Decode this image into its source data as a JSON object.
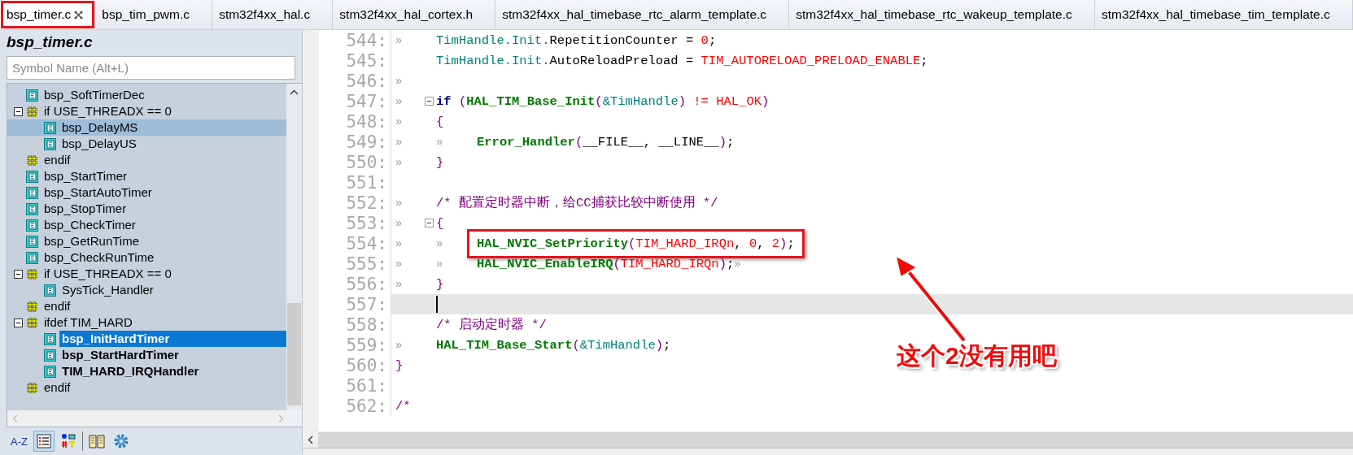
{
  "tabs": [
    {
      "label": "bsp_timer.c",
      "selected": true,
      "boxed": true
    },
    {
      "label": "bsp_tim_pwm.c",
      "selected": false,
      "boxed": false
    },
    {
      "label": "stm32f4xx_hal.c",
      "selected": false,
      "boxed": false
    },
    {
      "label": "stm32f4xx_hal_cortex.h",
      "selected": false,
      "boxed": false
    },
    {
      "label": "stm32f4xx_hal_timebase_rtc_alarm_template.c",
      "selected": false,
      "boxed": false
    },
    {
      "label": "stm32f4xx_hal_timebase_rtc_wakeup_template.c",
      "selected": false,
      "boxed": false
    },
    {
      "label": "stm32f4xx_hal_timebase_tim_template.c",
      "selected": false,
      "boxed": false
    }
  ],
  "symbols": {
    "title": "bsp_timer.c",
    "search": {
      "placeholder": "Symbol Name (Alt+L)"
    },
    "tree": [
      {
        "kind": "function",
        "label": "bsp_SoftTimerDec",
        "bold": false,
        "selected": false,
        "hovered": false
      },
      {
        "kind": "directive",
        "label": "if USE_THREADX == 0",
        "bold": false,
        "selected": false,
        "hovered": false,
        "expanded": true,
        "children": [
          {
            "kind": "function",
            "label": "bsp_DelayMS",
            "bold": false,
            "selected": false,
            "hovered": true
          },
          {
            "kind": "function",
            "label": "bsp_DelayUS",
            "bold": false,
            "selected": false,
            "hovered": false
          }
        ]
      },
      {
        "kind": "directive",
        "label": "endif",
        "bold": false,
        "selected": false,
        "hovered": false
      },
      {
        "kind": "function",
        "label": "bsp_StartTimer",
        "bold": false,
        "selected": false,
        "hovered": false
      },
      {
        "kind": "function",
        "label": "bsp_StartAutoTimer",
        "bold": false,
        "selected": false,
        "hovered": false
      },
      {
        "kind": "function",
        "label": "bsp_StopTimer",
        "bold": false,
        "selected": false,
        "hovered": false
      },
      {
        "kind": "function",
        "label": "bsp_CheckTimer",
        "bold": false,
        "selected": false,
        "hovered": false
      },
      {
        "kind": "function",
        "label": "bsp_GetRunTime",
        "bold": false,
        "selected": false,
        "hovered": false
      },
      {
        "kind": "function",
        "label": "bsp_CheckRunTime",
        "bold": false,
        "selected": false,
        "hovered": false
      },
      {
        "kind": "directive",
        "label": "if USE_THREADX == 0",
        "bold": false,
        "selected": false,
        "hovered": false,
        "expanded": true,
        "children": [
          {
            "kind": "function",
            "label": "SysTick_Handler",
            "bold": false,
            "selected": false,
            "hovered": false
          }
        ]
      },
      {
        "kind": "directive",
        "label": "endif",
        "bold": false,
        "selected": false,
        "hovered": false
      },
      {
        "kind": "directive",
        "label": "ifdef TIM_HARD",
        "bold": false,
        "selected": false,
        "hovered": false,
        "expanded": true,
        "children": [
          {
            "kind": "function",
            "label": "bsp_InitHardTimer",
            "bold": true,
            "selected": true,
            "hovered": false
          },
          {
            "kind": "function",
            "label": "bsp_StartHardTimer",
            "bold": true,
            "selected": false,
            "hovered": false
          },
          {
            "kind": "function",
            "label": "TIM_HARD_IRQHandler",
            "bold": true,
            "selected": false,
            "hovered": false
          }
        ]
      },
      {
        "kind": "directive",
        "label": "endif",
        "bold": false,
        "selected": false,
        "hovered": false
      }
    ],
    "toolbar": [
      {
        "kind": "sort",
        "label": "A-Z",
        "selected": false
      },
      {
        "kind": "list",
        "selected": true
      },
      {
        "kind": "categories",
        "selected": false
      },
      {
        "kind": "book",
        "selected": false
      },
      {
        "kind": "gear",
        "selected": false
      }
    ]
  },
  "editor": {
    "lines": [
      {
        "number": "544:",
        "fold": false,
        "current": false,
        "boxed": false,
        "tokens": [
          {
            "kind": "tab",
            "text": "»"
          },
          {
            "kind": "member",
            "text": "TimHandle.Init."
          },
          {
            "kind": "plain",
            "text": "RepetitionCounter = "
          },
          {
            "kind": "number",
            "text": "0"
          },
          {
            "kind": "plain",
            "text": ";"
          }
        ]
      },
      {
        "number": "545:",
        "fold": false,
        "current": false,
        "boxed": false,
        "tokens": [
          {
            "kind": "gap"
          },
          {
            "kind": "member",
            "text": "TimHandle.Init."
          },
          {
            "kind": "plain",
            "text": "AutoReloadPreload = "
          },
          {
            "kind": "macro",
            "text": "TIM_AUTORELOAD_PRELOAD_ENABLE"
          },
          {
            "kind": "plain",
            "text": ";"
          }
        ]
      },
      {
        "number": "546:",
        "fold": false,
        "current": false,
        "boxed": false,
        "tokens": [
          {
            "kind": "tab",
            "text": "»"
          }
        ]
      },
      {
        "number": "547:",
        "fold": true,
        "current": false,
        "boxed": false,
        "tokens": [
          {
            "kind": "tab",
            "text": "»"
          },
          {
            "kind": "keyword",
            "text": "if "
          },
          {
            "kind": "paren",
            "text": "("
          },
          {
            "kind": "func",
            "text": "HAL_TIM_Base_Init"
          },
          {
            "kind": "paren",
            "text": "("
          },
          {
            "kind": "member",
            "text": "&TimHandle"
          },
          {
            "kind": "paren",
            "text": ")"
          },
          {
            "kind": "operator",
            "text": " != "
          },
          {
            "kind": "macro",
            "text": "HAL_OK"
          },
          {
            "kind": "paren",
            "text": ")"
          }
        ]
      },
      {
        "number": "548:",
        "fold": false,
        "current": false,
        "boxed": false,
        "tokens": [
          {
            "kind": "tab",
            "text": "»"
          },
          {
            "kind": "paren",
            "text": "{"
          }
        ]
      },
      {
        "number": "549:",
        "fold": false,
        "current": false,
        "boxed": false,
        "tokens": [
          {
            "kind": "tab",
            "text": "»"
          },
          {
            "kind": "tab",
            "text": "»"
          },
          {
            "kind": "func",
            "text": "Error_Handler"
          },
          {
            "kind": "paren",
            "text": "("
          },
          {
            "kind": "plain",
            "text": "__FILE__, __LINE__"
          },
          {
            "kind": "paren",
            "text": ")"
          },
          {
            "kind": "plain",
            "text": ";"
          }
        ]
      },
      {
        "number": "550:",
        "fold": false,
        "current": false,
        "boxed": false,
        "tokens": [
          {
            "kind": "tab",
            "text": "»"
          },
          {
            "kind": "paren",
            "text": "}"
          }
        ]
      },
      {
        "number": "551:",
        "fold": false,
        "current": false,
        "boxed": false
      },
      {
        "number": "552:",
        "fold": false,
        "current": false,
        "boxed": false,
        "tokens": [
          {
            "kind": "tab",
            "text": "»"
          },
          {
            "kind": "comment",
            "text": "/* 配置定时器中断，给CC捕获比较中断使用 */"
          }
        ]
      },
      {
        "number": "553:",
        "fold": true,
        "current": false,
        "boxed": false,
        "tokens": [
          {
            "kind": "tab",
            "text": "»"
          },
          {
            "kind": "paren",
            "text": "{"
          }
        ]
      },
      {
        "number": "554:",
        "fold": false,
        "current": false,
        "boxed": true,
        "tokens": [
          {
            "kind": "tab",
            "text": "»"
          },
          {
            "kind": "tab",
            "text": "»"
          },
          {
            "kind": "func",
            "text": "HAL_NVIC_SetPriority"
          },
          {
            "kind": "paren",
            "text": "("
          },
          {
            "kind": "macro",
            "text": "TIM_HARD_IRQn"
          },
          {
            "kind": "plain",
            "text": ", "
          },
          {
            "kind": "number",
            "text": "0"
          },
          {
            "kind": "plain",
            "text": ", "
          },
          {
            "kind": "number",
            "text": "2"
          },
          {
            "kind": "paren",
            "text": ")"
          },
          {
            "kind": "plain",
            "text": ";"
          }
        ]
      },
      {
        "number": "555:",
        "fold": false,
        "current": false,
        "boxed": false,
        "tokens": [
          {
            "kind": "tab",
            "text": "»"
          },
          {
            "kind": "tab",
            "text": "»"
          },
          {
            "kind": "func",
            "text": "HAL_NVIC_EnableIRQ"
          },
          {
            "kind": "paren",
            "text": "("
          },
          {
            "kind": "macro",
            "text": "TIM_HARD_IRQn"
          },
          {
            "kind": "paren",
            "text": ")"
          },
          {
            "kind": "plain",
            "text": ";"
          },
          {
            "kind": "tab",
            "text": "»"
          }
        ]
      },
      {
        "number": "556:",
        "fold": false,
        "current": false,
        "boxed": false,
        "tokens": [
          {
            "kind": "tab",
            "text": "»"
          },
          {
            "kind": "paren",
            "text": "}"
          }
        ]
      },
      {
        "number": "557:",
        "fold": false,
        "current": true,
        "boxed": false
      },
      {
        "number": "558:",
        "fold": false,
        "current": false,
        "boxed": false,
        "tokens": [
          {
            "kind": "gap"
          },
          {
            "kind": "comment",
            "text": "/* 启动定时器 */"
          }
        ]
      },
      {
        "number": "559:",
        "fold": false,
        "current": false,
        "boxed": false,
        "tokens": [
          {
            "kind": "tab",
            "text": "»"
          },
          {
            "kind": "func",
            "text": "HAL_TIM_Base_Start"
          },
          {
            "kind": "paren",
            "text": "("
          },
          {
            "kind": "member",
            "text": "&TimHandle"
          },
          {
            "kind": "paren",
            "text": ")"
          },
          {
            "kind": "plain",
            "text": ";"
          }
        ]
      },
      {
        "number": "560:",
        "fold": false,
        "current": false,
        "boxed": false,
        "tokens": [
          {
            "kind": "paren",
            "text": "}"
          }
        ]
      },
      {
        "number": "561:",
        "fold": false,
        "current": false,
        "boxed": false
      },
      {
        "number": "562:",
        "fold": false,
        "current": false,
        "boxed": false,
        "tokens": [
          {
            "kind": "comment",
            "text": "/*"
          }
        ]
      }
    ],
    "annotation": {
      "text": "这个2没有用吧"
    }
  }
}
